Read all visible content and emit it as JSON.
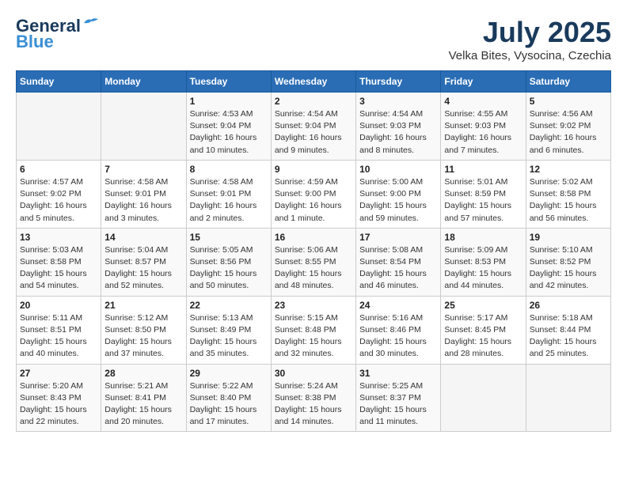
{
  "header": {
    "logo_general": "General",
    "logo_blue": "Blue",
    "month_title": "July 2025",
    "location": "Velka Bites, Vysocina, Czechia"
  },
  "calendar": {
    "days_of_week": [
      "Sunday",
      "Monday",
      "Tuesday",
      "Wednesday",
      "Thursday",
      "Friday",
      "Saturday"
    ],
    "weeks": [
      [
        {
          "day": "",
          "info": ""
        },
        {
          "day": "",
          "info": ""
        },
        {
          "day": "1",
          "info": "Sunrise: 4:53 AM\nSunset: 9:04 PM\nDaylight: 16 hours\nand 10 minutes."
        },
        {
          "day": "2",
          "info": "Sunrise: 4:54 AM\nSunset: 9:04 PM\nDaylight: 16 hours\nand 9 minutes."
        },
        {
          "day": "3",
          "info": "Sunrise: 4:54 AM\nSunset: 9:03 PM\nDaylight: 16 hours\nand 8 minutes."
        },
        {
          "day": "4",
          "info": "Sunrise: 4:55 AM\nSunset: 9:03 PM\nDaylight: 16 hours\nand 7 minutes."
        },
        {
          "day": "5",
          "info": "Sunrise: 4:56 AM\nSunset: 9:02 PM\nDaylight: 16 hours\nand 6 minutes."
        }
      ],
      [
        {
          "day": "6",
          "info": "Sunrise: 4:57 AM\nSunset: 9:02 PM\nDaylight: 16 hours\nand 5 minutes."
        },
        {
          "day": "7",
          "info": "Sunrise: 4:58 AM\nSunset: 9:01 PM\nDaylight: 16 hours\nand 3 minutes."
        },
        {
          "day": "8",
          "info": "Sunrise: 4:58 AM\nSunset: 9:01 PM\nDaylight: 16 hours\nand 2 minutes."
        },
        {
          "day": "9",
          "info": "Sunrise: 4:59 AM\nSunset: 9:00 PM\nDaylight: 16 hours\nand 1 minute."
        },
        {
          "day": "10",
          "info": "Sunrise: 5:00 AM\nSunset: 9:00 PM\nDaylight: 15 hours\nand 59 minutes."
        },
        {
          "day": "11",
          "info": "Sunrise: 5:01 AM\nSunset: 8:59 PM\nDaylight: 15 hours\nand 57 minutes."
        },
        {
          "day": "12",
          "info": "Sunrise: 5:02 AM\nSunset: 8:58 PM\nDaylight: 15 hours\nand 56 minutes."
        }
      ],
      [
        {
          "day": "13",
          "info": "Sunrise: 5:03 AM\nSunset: 8:58 PM\nDaylight: 15 hours\nand 54 minutes."
        },
        {
          "day": "14",
          "info": "Sunrise: 5:04 AM\nSunset: 8:57 PM\nDaylight: 15 hours\nand 52 minutes."
        },
        {
          "day": "15",
          "info": "Sunrise: 5:05 AM\nSunset: 8:56 PM\nDaylight: 15 hours\nand 50 minutes."
        },
        {
          "day": "16",
          "info": "Sunrise: 5:06 AM\nSunset: 8:55 PM\nDaylight: 15 hours\nand 48 minutes."
        },
        {
          "day": "17",
          "info": "Sunrise: 5:08 AM\nSunset: 8:54 PM\nDaylight: 15 hours\nand 46 minutes."
        },
        {
          "day": "18",
          "info": "Sunrise: 5:09 AM\nSunset: 8:53 PM\nDaylight: 15 hours\nand 44 minutes."
        },
        {
          "day": "19",
          "info": "Sunrise: 5:10 AM\nSunset: 8:52 PM\nDaylight: 15 hours\nand 42 minutes."
        }
      ],
      [
        {
          "day": "20",
          "info": "Sunrise: 5:11 AM\nSunset: 8:51 PM\nDaylight: 15 hours\nand 40 minutes."
        },
        {
          "day": "21",
          "info": "Sunrise: 5:12 AM\nSunset: 8:50 PM\nDaylight: 15 hours\nand 37 minutes."
        },
        {
          "day": "22",
          "info": "Sunrise: 5:13 AM\nSunset: 8:49 PM\nDaylight: 15 hours\nand 35 minutes."
        },
        {
          "day": "23",
          "info": "Sunrise: 5:15 AM\nSunset: 8:48 PM\nDaylight: 15 hours\nand 32 minutes."
        },
        {
          "day": "24",
          "info": "Sunrise: 5:16 AM\nSunset: 8:46 PM\nDaylight: 15 hours\nand 30 minutes."
        },
        {
          "day": "25",
          "info": "Sunrise: 5:17 AM\nSunset: 8:45 PM\nDaylight: 15 hours\nand 28 minutes."
        },
        {
          "day": "26",
          "info": "Sunrise: 5:18 AM\nSunset: 8:44 PM\nDaylight: 15 hours\nand 25 minutes."
        }
      ],
      [
        {
          "day": "27",
          "info": "Sunrise: 5:20 AM\nSunset: 8:43 PM\nDaylight: 15 hours\nand 22 minutes."
        },
        {
          "day": "28",
          "info": "Sunrise: 5:21 AM\nSunset: 8:41 PM\nDaylight: 15 hours\nand 20 minutes."
        },
        {
          "day": "29",
          "info": "Sunrise: 5:22 AM\nSunset: 8:40 PM\nDaylight: 15 hours\nand 17 minutes."
        },
        {
          "day": "30",
          "info": "Sunrise: 5:24 AM\nSunset: 8:38 PM\nDaylight: 15 hours\nand 14 minutes."
        },
        {
          "day": "31",
          "info": "Sunrise: 5:25 AM\nSunset: 8:37 PM\nDaylight: 15 hours\nand 11 minutes."
        },
        {
          "day": "",
          "info": ""
        },
        {
          "day": "",
          "info": ""
        }
      ]
    ]
  }
}
